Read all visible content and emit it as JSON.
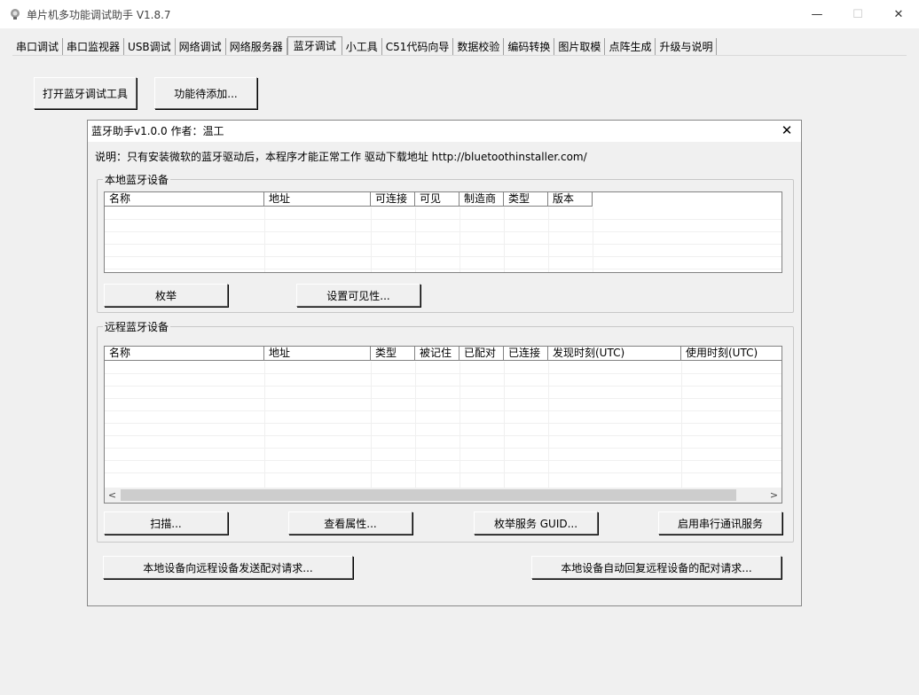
{
  "window": {
    "title": "单片机多功能调试助手 V1.8.7",
    "minimize": "—",
    "maximize": "☐",
    "close": "✕"
  },
  "tabs": [
    {
      "label": "串口调试"
    },
    {
      "label": "串口监视器"
    },
    {
      "label": "USB调试"
    },
    {
      "label": "网络调试"
    },
    {
      "label": "网络服务器"
    },
    {
      "label": "蓝牙调试",
      "active": true
    },
    {
      "label": "小工具"
    },
    {
      "label": "C51代码向导"
    },
    {
      "label": "数据校验"
    },
    {
      "label": "编码转换"
    },
    {
      "label": "图片取模"
    },
    {
      "label": "点阵生成"
    },
    {
      "label": "升级与说明"
    }
  ],
  "toolbar": {
    "open_tool": "打开蓝牙调试工具",
    "pending": "功能待添加..."
  },
  "dialog": {
    "title": "蓝牙助手v1.0.0 作者：温工",
    "close": "✕",
    "note": "说明：只有安装微软的蓝牙驱动后，本程序才能正常工作 驱动下载地址 http://bluetoothinstaller.com/",
    "local_group": {
      "label": "本地蓝牙设备",
      "columns": [
        "名称",
        "地址",
        "可连接",
        "可见",
        "制造商",
        "类型",
        "版本"
      ],
      "enumerate_button": "枚举",
      "visibility_button": "设置可见性..."
    },
    "remote_group": {
      "label": "远程蓝牙设备",
      "columns": [
        "名称",
        "地址",
        "类型",
        "被记住",
        "已配对",
        "已连接",
        "发现时刻(UTC)",
        "使用时刻(UTC)"
      ],
      "scroll_left": "<",
      "scroll_right": ">",
      "scan_button": "扫描...",
      "properties_button": "查看属性...",
      "enum_services_button": "枚举服务 GUID...",
      "serial_service_button": "启用串行通讯服务"
    },
    "send_pair_button": "本地设备向远程设备发送配对请求...",
    "auto_reply_button": "本地设备自动回复远程设备的配对请求..."
  }
}
